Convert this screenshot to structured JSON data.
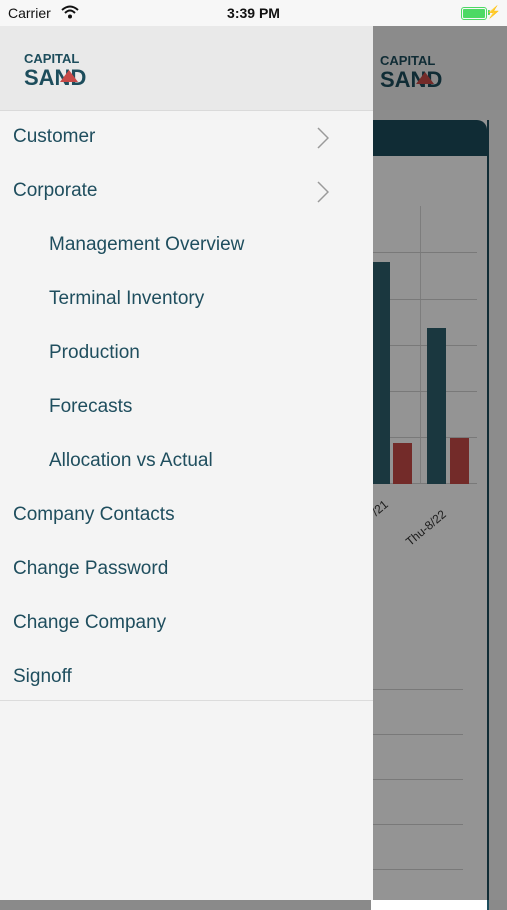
{
  "status_bar": {
    "carrier": "Carrier",
    "time": "3:39 PM"
  },
  "brand": {
    "line1": "CAPITAL",
    "line2": "SAND"
  },
  "menu": [
    {
      "label": "Customer",
      "level": 1,
      "chevron": true
    },
    {
      "label": "Corporate",
      "level": 1,
      "chevron": true
    },
    {
      "label": "Management Overview",
      "level": 2,
      "chevron": false
    },
    {
      "label": "Terminal Inventory",
      "level": 2,
      "chevron": false
    },
    {
      "label": "Production",
      "level": 2,
      "chevron": false
    },
    {
      "label": "Forecasts",
      "level": 2,
      "chevron": false
    },
    {
      "label": "Allocation vs Actual",
      "level": 2,
      "chevron": false
    },
    {
      "label": "Company Contacts",
      "level": 1,
      "chevron": false
    },
    {
      "label": "Change Password",
      "level": 1,
      "chevron": false
    },
    {
      "label": "Change Company",
      "level": 1,
      "chevron": false
    },
    {
      "label": "Signoff",
      "level": 1,
      "chevron": false
    }
  ],
  "background_chart": {
    "x_ticks": [
      "/21",
      "Thu-8/22"
    ],
    "colors": {
      "primary": "#2e5f6d",
      "secondary": "#c64a48",
      "header": "#1d4d5c"
    }
  }
}
